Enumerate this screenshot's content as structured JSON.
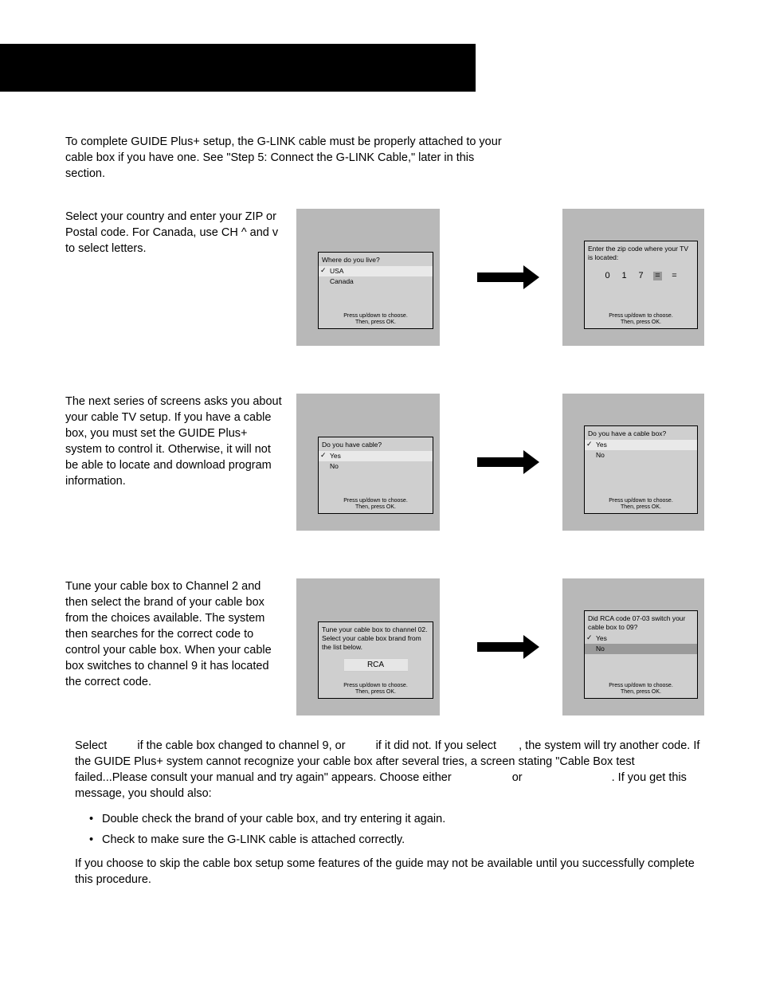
{
  "intro": "To complete GUIDE Plus+ setup, the G-LINK cable must be properly attached to your cable box if you have one. See \"Step 5: Connect the G-LINK Cable,\" later in this section.",
  "row1": {
    "text": "Select your country and enter your ZIP or Postal code. For Canada, use CH ^ and v to select letters.",
    "screenA": {
      "q": "Where do you live?",
      "o1": "USA",
      "o2": "Canada",
      "foot1": "Press up/down to choose.",
      "foot2": "Then, press OK."
    },
    "screenB": {
      "q": "Enter the zip code where your TV is located:",
      "d1": "0",
      "d2": "1",
      "d3": "7",
      "d4": "=",
      "d5": "=",
      "foot1": "Press up/down to choose.",
      "foot2": "Then, press OK."
    }
  },
  "row2": {
    "text": "The next series of screens asks you about your cable TV setup. If you have a cable box, you must set the GUIDE Plus+ system to control it. Otherwise, it will not be able to locate and download program information.",
    "screenA": {
      "q": "Do you have cable?",
      "o1": "Yes",
      "o2": "No",
      "foot1": "Press up/down to choose.",
      "foot2": "Then, press OK."
    },
    "screenB": {
      "q": "Do you have a cable box?",
      "o1": "Yes",
      "o2": "No",
      "foot1": "Press up/down to choose.",
      "foot2": "Then, press OK."
    }
  },
  "row3": {
    "text": "Tune your cable box to Channel 2 and then select the brand of your cable box from the choices available. The system then searches for the correct code to control your cable box. When your cable box switches to channel 9 it has located the correct code.",
    "screenA": {
      "q": "Tune your cable box to channel 02. Select your cable box brand from the list below.",
      "brand": "RCA",
      "foot1": "Press up/down to choose.",
      "foot2": "Then, press OK."
    },
    "screenB": {
      "q": "Did RCA code 07-03 switch your cable box to 09?",
      "o1": "Yes",
      "o2": "No",
      "foot1": "Press up/down to choose.",
      "foot2": "Then, press OK."
    }
  },
  "bottom": {
    "p1a": "Select",
    "p1b": "if the cable box changed to channel 9, or",
    "p1c": "if it did not. If you select",
    "p1d": ", the system will try another code. If the GUIDE Plus+ system cannot recognize your cable box after several tries, a screen stating \"Cable Box test failed...Please consult your manual and try again\" appears. Choose either",
    "p1e": "or",
    "p1f": ". If you get this message, you should also:",
    "b1": "Double check the brand of your cable box, and try entering it again.",
    "b2": "Check to make sure the G-LINK cable is attached correctly.",
    "p2": "If you choose to skip the cable box setup some features of the guide may not be available until you successfully complete this procedure."
  }
}
